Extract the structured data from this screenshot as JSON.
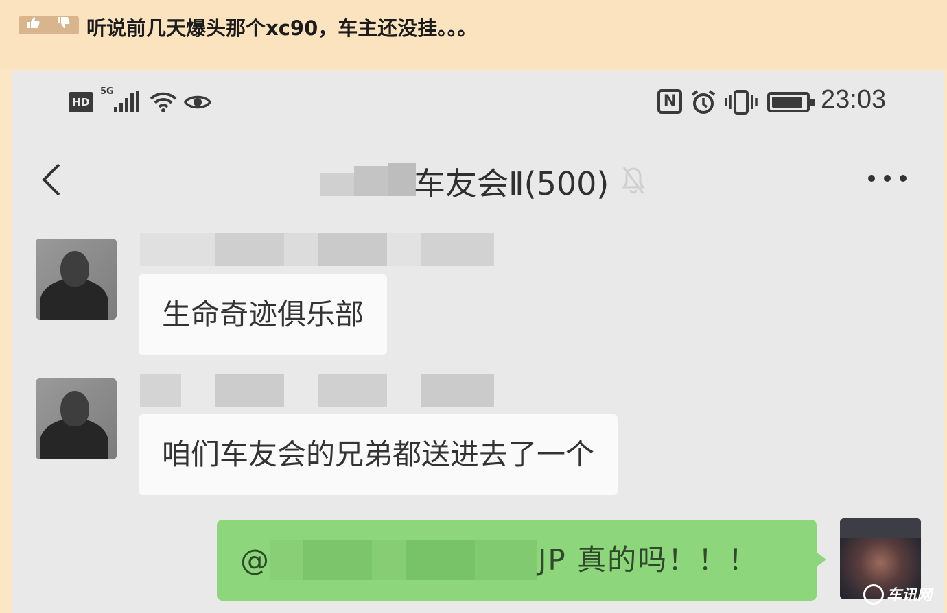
{
  "post": {
    "vote_up_icon": "thumbs-up-icon",
    "vote_down_icon": "thumbs-down-icon",
    "title": "听说前几天爆头那个xc90，车主还没挂。。。"
  },
  "status_bar": {
    "hd_label": "HD",
    "network_label": "5G",
    "time": "23:03",
    "nfc_label": "N"
  },
  "chat": {
    "title": "车友会Ⅱ(500)",
    "messages": [
      {
        "side": "left",
        "text": "生命奇迹俱乐部"
      },
      {
        "side": "left",
        "text": "咱们车友会的兄弟都送进去了一个"
      },
      {
        "side": "right",
        "prefix": "@",
        "text": "JP 真的吗！！！"
      }
    ]
  },
  "watermark": {
    "text": "车讯网"
  },
  "colors": {
    "page_bg": "#fbe3bf",
    "phone_bg": "#e9e9e9",
    "bubble_left": "#fafafa",
    "bubble_right": "#8ed67c"
  }
}
